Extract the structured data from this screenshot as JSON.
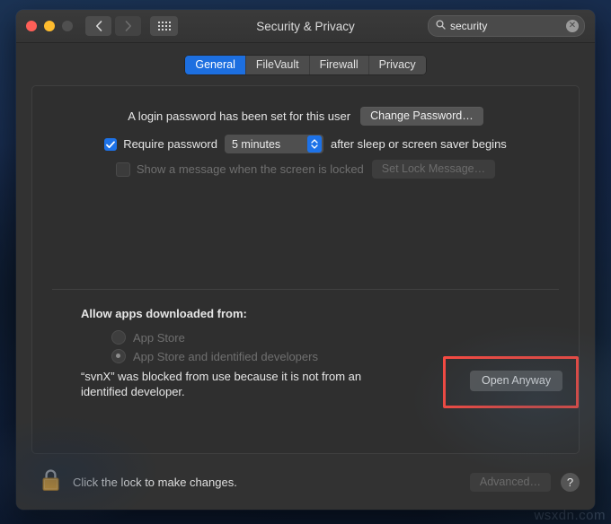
{
  "desktop": {
    "watermark": "wsxdn.com"
  },
  "window": {
    "title": "Security & Privacy",
    "traffic_lights": [
      {
        "name": "close",
        "color": "#ff5f57"
      },
      {
        "name": "minimize",
        "color": "#febc2e"
      },
      {
        "name": "zoom",
        "color": "#4f4f4f"
      }
    ],
    "nav": {
      "back_icon": "chevron-left-icon",
      "forward_icon": "chevron-right-icon",
      "grid_icon": "show-all-grid-icon"
    },
    "search": {
      "icon": "search-icon",
      "value": "security",
      "placeholder": "Search",
      "clear_icon": "clear-icon",
      "clear_glyph": "✕"
    }
  },
  "tabs": [
    {
      "label": "General",
      "active": true
    },
    {
      "label": "FileVault",
      "active": false
    },
    {
      "label": "Firewall",
      "active": false
    },
    {
      "label": "Privacy",
      "active": false
    }
  ],
  "general": {
    "password_status": "A login password has been set for this user",
    "change_password_button": "Change Password…",
    "require_password": {
      "checked": true,
      "label": "Require password",
      "interval_value": "5 minutes",
      "suffix": "after sleep or screen saver begins"
    },
    "lock_message": {
      "checked": false,
      "label": "Show a message when the screen is locked",
      "button": "Set Lock Message…",
      "disabled": true
    },
    "allow_apps_label": "Allow apps downloaded from:",
    "allow_options": [
      {
        "label": "App Store",
        "selected": false
      },
      {
        "label": "App Store and identified developers",
        "selected": true
      }
    ],
    "blocked_message": "“svnX” was blocked from use because it is not from an identified developer.",
    "open_anyway_button": "Open Anyway",
    "highlight_color": "#fb4a41"
  },
  "footer": {
    "lock_icon": "lock-closed-icon",
    "lock_text": "Click the lock to make changes.",
    "advanced_button": "Advanced…",
    "help_button": "?"
  },
  "colors": {
    "accent_blue": "#1d72e8",
    "window_bg": "#323232",
    "content_bg": "#2f2f2f",
    "highlight_red": "#fb4a41",
    "lock_gold": "#e8a93a"
  }
}
